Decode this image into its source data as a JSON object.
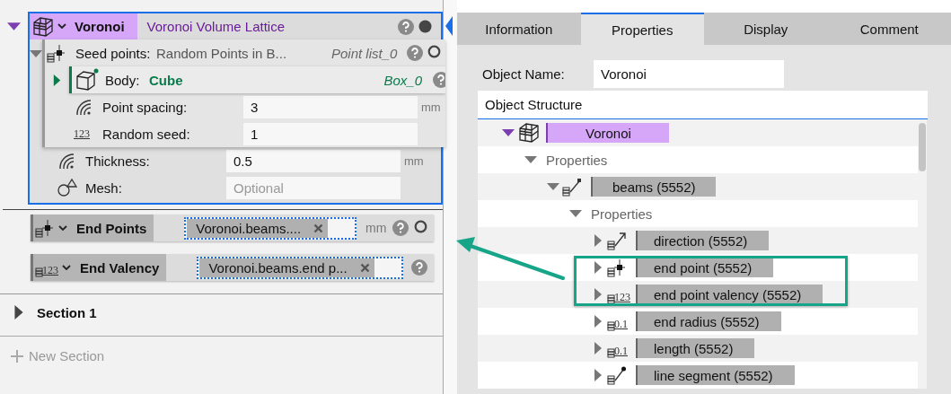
{
  "editor": {
    "node": {
      "name": "Voronoi",
      "title": "Voronoi Volume Lattice",
      "expanded": true,
      "selected": true,
      "dot_filled": true,
      "inputs": [
        {
          "kind": "group",
          "label": "Seed points:",
          "value": "Random Points in B...",
          "ref": "Point list_0",
          "expanded": true,
          "dot_filled": false,
          "children": [
            {
              "kind": "link",
              "label": "Body:",
              "value": "Cube",
              "ref": "Box_0",
              "expanded": false
            },
            {
              "kind": "measure",
              "label": "Point spacing:",
              "value": "3",
              "unit": "mm"
            },
            {
              "kind": "number",
              "icon_text": "123",
              "label": "Random seed:",
              "value": "1"
            }
          ]
        },
        {
          "kind": "measure",
          "label": "Thickness:",
          "value": "0.5",
          "unit": "mm"
        },
        {
          "kind": "mesh",
          "label": "Mesh:",
          "placeholder": "Optional"
        }
      ]
    },
    "outputs": [
      {
        "kind": "point",
        "label": "End Points",
        "chip": "Voronoi.beams....",
        "unit": "mm",
        "dot_filled": false
      },
      {
        "kind": "valency",
        "icon_text": "123",
        "label": "End Valency",
        "chip": "Voronoi.beams.end p..."
      }
    ],
    "sections": [
      {
        "label": "Section 1",
        "expanded": false
      }
    ],
    "new_section": "New Section"
  },
  "inspector": {
    "tabs": [
      {
        "label": "Information",
        "selected": false
      },
      {
        "label": "Properties",
        "selected": true
      },
      {
        "label": "Display",
        "selected": false
      },
      {
        "label": "Comment",
        "selected": false
      }
    ],
    "object_name_label": "Object Name:",
    "object_name": "Voronoi",
    "structure_title": "Object Structure",
    "tree": [
      {
        "kind": "lattice",
        "label": "Voronoi",
        "expanded": true,
        "children": [
          {
            "kind": "group",
            "label": "Properties",
            "expanded": true,
            "children": [
              {
                "kind": "beams",
                "label": "beams (5552)",
                "expanded": true,
                "children": [
                  {
                    "kind": "group",
                    "label": "Properties",
                    "expanded": true,
                    "children": [
                      {
                        "kind": "direction",
                        "label": "direction (5552)",
                        "expanded": false,
                        "highlighted": false
                      },
                      {
                        "kind": "point",
                        "label": "end point (5552)",
                        "expanded": false,
                        "highlighted": true
                      },
                      {
                        "kind": "valency",
                        "icon_text": "123",
                        "label": "end point valency (5552)",
                        "expanded": false,
                        "highlighted": true
                      },
                      {
                        "kind": "scalar",
                        "icon_text": "0.1",
                        "label": "end radius (5552)",
                        "expanded": false,
                        "highlighted": false
                      },
                      {
                        "kind": "scalar",
                        "icon_text": "0.1",
                        "label": "length (5552)",
                        "expanded": false,
                        "highlighted": false
                      },
                      {
                        "kind": "segment",
                        "label": "line segment (5552)",
                        "expanded": false,
                        "highlighted": false
                      }
                    ]
                  }
                ]
              }
            ]
          }
        ]
      }
    ]
  }
}
